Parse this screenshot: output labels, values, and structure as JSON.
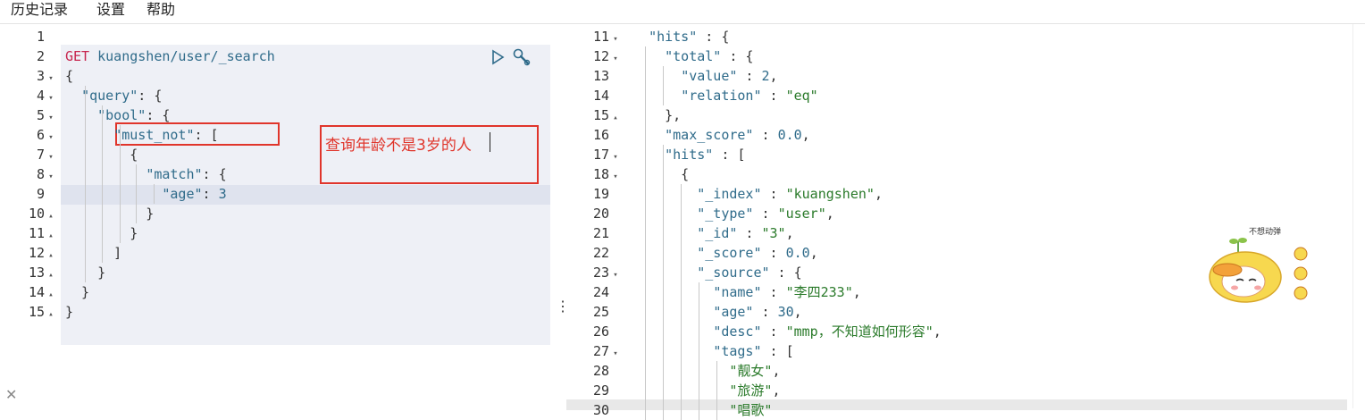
{
  "menu": {
    "items": [
      "历史记录",
      "设置",
      "帮助"
    ]
  },
  "left_editor": {
    "line_numbers": [
      "1",
      "2",
      "3",
      "4",
      "5",
      "6",
      "7",
      "8",
      "9",
      "10",
      "11",
      "12",
      "13",
      "14",
      "15"
    ],
    "fold_markers": [
      "",
      "",
      "▾",
      "▾",
      "▾",
      "▾",
      "▾",
      "▾",
      "",
      "▴",
      "▴",
      "▴",
      "▴",
      "▴",
      "▴"
    ],
    "request": {
      "method": "GET",
      "url": "kuangshen/user/_search"
    },
    "lines": [
      "{",
      "  \"query\": {",
      "    \"bool\": {",
      "      \"must_not\": [",
      "        {",
      "          \"match\": {",
      "            \"age\": 3",
      "          }",
      "        }",
      "      ]",
      "    }",
      "  }",
      "}"
    ],
    "annotation": "查询年龄不是3岁的人"
  },
  "right_editor": {
    "line_numbers": [
      "11",
      "12",
      "13",
      "14",
      "15",
      "16",
      "17",
      "18",
      "19",
      "20",
      "21",
      "22",
      "23",
      "24",
      "25",
      "26",
      "27",
      "28",
      "29",
      "30"
    ],
    "fold_markers": [
      "▾",
      "▾",
      "",
      "",
      "▴",
      "",
      "▾",
      "▾",
      "",
      "",
      "",
      "",
      "▾",
      "",
      "",
      "",
      "▾",
      "",
      "",
      ""
    ],
    "lines": [
      "  \"hits\" : {",
      "    \"total\" : {",
      "      \"value\" : 2,",
      "      \"relation\" : \"eq\"",
      "    },",
      "    \"max_score\" : 0.0,",
      "    \"hits\" : [",
      "      {",
      "        \"_index\" : \"kuangshen\",",
      "        \"_type\" : \"user\",",
      "        \"_id\" : \"3\",",
      "        \"_score\" : 0.0,",
      "        \"_source\" : {",
      "          \"name\" : \"李四233\",",
      "          \"age\" : 30,",
      "          \"desc\" : \"mmp，不知道如何形容\",",
      "          \"tags\" : [",
      "            \"靓女\",",
      "            \"旅游\",",
      "            \"唱歌\""
    ]
  },
  "sticker": {
    "caption": "不想动弹"
  },
  "colors": {
    "accent_red": "#e0352b",
    "method": "#c7254e",
    "key": "#2f6b8a",
    "string": "#2a7a2a"
  }
}
